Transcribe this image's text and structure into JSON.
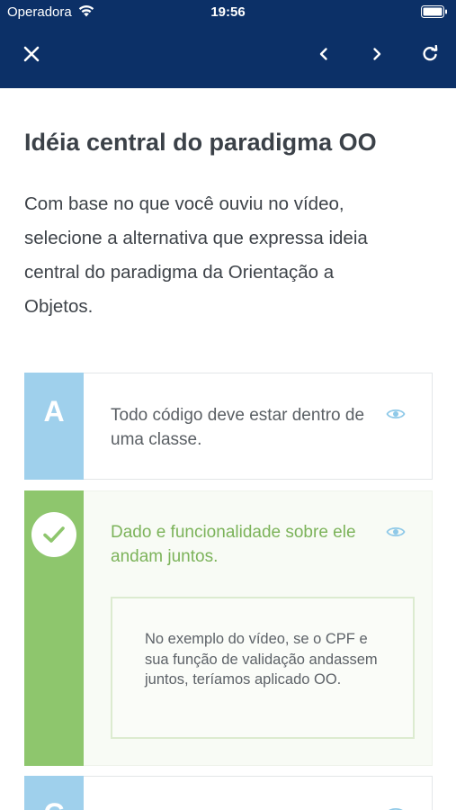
{
  "status_bar": {
    "carrier": "Operadora",
    "time": "19:56"
  },
  "toolbar": {
    "close_icon": "close-icon",
    "prev_icon": "chevron-left-icon",
    "next_icon": "chevron-right-icon",
    "reload_icon": "reload-icon"
  },
  "lesson": {
    "title": "Idéia central do paradigma OO",
    "question": "Com base no que você ouviu no vídeo, selecione a alternativa que expressa ideia central do paradigma da Orientação a Objetos."
  },
  "options": [
    {
      "letter": "A",
      "text": "Todo código deve estar dentro de uma classe.",
      "state": "unselected"
    },
    {
      "letter": "",
      "text": "Dado e funcionalidade sobre ele andam juntos.",
      "state": "correct",
      "feedback": "No exemplo do vídeo, se o CPF e sua função de validação andassem juntos, teríamos aplicado OO."
    },
    {
      "letter": "C",
      "text": "",
      "state": "unselected"
    }
  ],
  "colors": {
    "header_bg": "#0c3067",
    "option_letter_bg": "#9fd0ec",
    "correct_green": "#8ec66d",
    "correct_text": "#7cb35a",
    "eye_icon": "#8fc9e8"
  }
}
